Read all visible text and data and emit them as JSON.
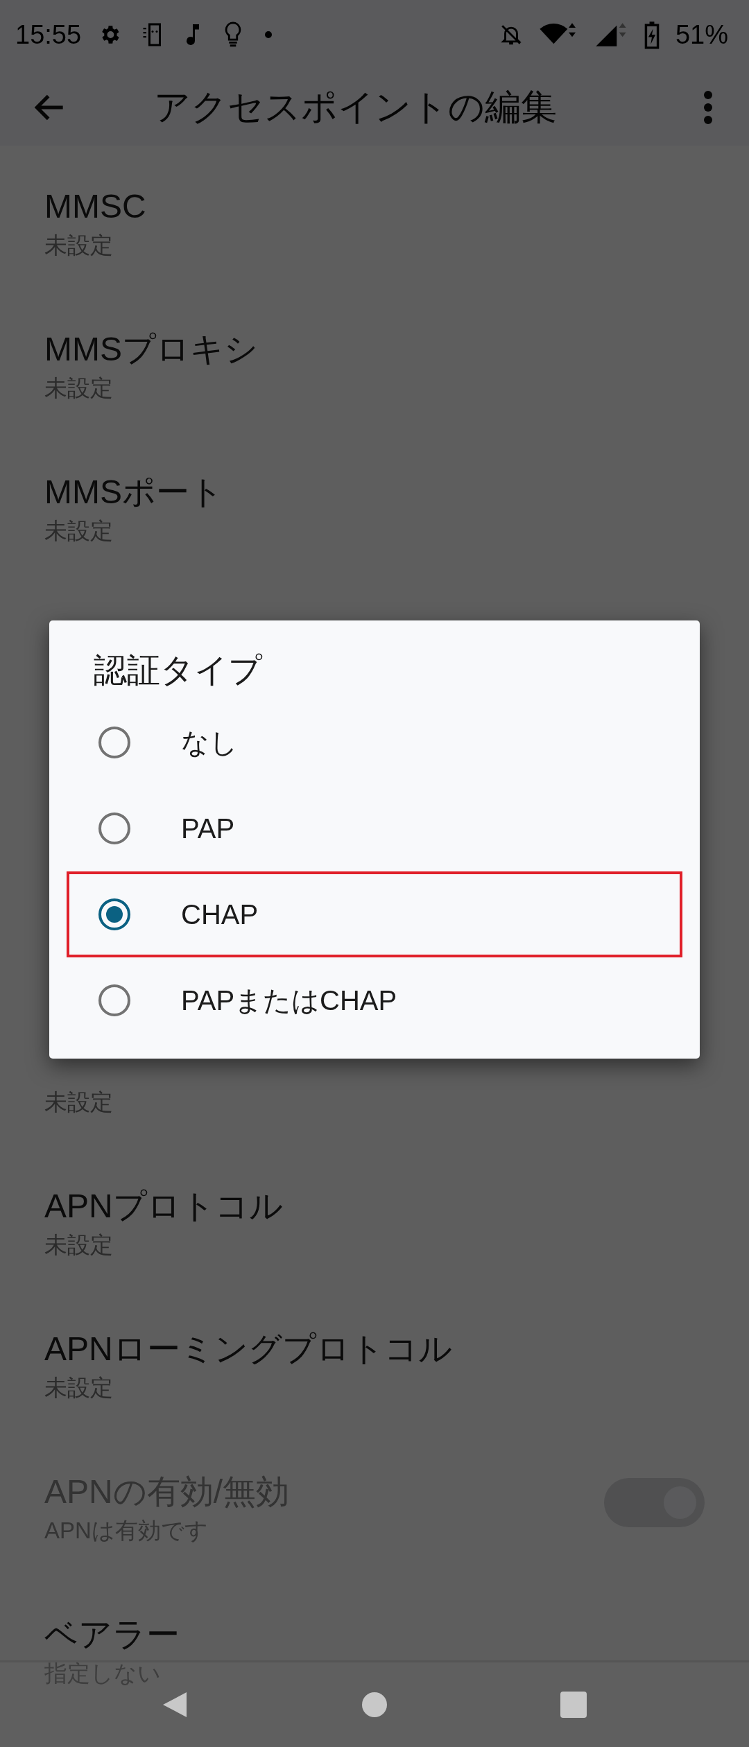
{
  "status_bar": {
    "time": "15:55",
    "battery": "51%"
  },
  "toolbar": {
    "title": "アクセスポイントの編集"
  },
  "settings": [
    {
      "kind": "text",
      "title": "MMSC",
      "summary": "未設定"
    },
    {
      "kind": "text",
      "title": "MMSプロキシ",
      "summary": "未設定"
    },
    {
      "kind": "text",
      "title": "MMSポート",
      "summary": "未設定"
    },
    {
      "kind": "covered"
    },
    {
      "kind": "covered"
    },
    {
      "kind": "covered"
    },
    {
      "kind": "text",
      "summary": "未設定"
    },
    {
      "kind": "text",
      "title": "APNプロトコル",
      "summary": "未設定"
    },
    {
      "kind": "text",
      "title": "APNローミングプロトコル",
      "summary": "未設定"
    },
    {
      "kind": "switch",
      "title": "APNの有効/無効",
      "summary": "APNは有効です",
      "disabled": true,
      "on": true
    },
    {
      "kind": "text",
      "title": "ベアラー",
      "summary": "指定しない"
    }
  ],
  "dialog": {
    "title": "認証タイプ",
    "options": [
      {
        "label": "なし",
        "selected": false,
        "highlighted": false
      },
      {
        "label": "PAP",
        "selected": false,
        "highlighted": false
      },
      {
        "label": "CHAP",
        "selected": true,
        "highlighted": true
      },
      {
        "label": "PAPまたはCHAP",
        "selected": false,
        "highlighted": false
      }
    ]
  }
}
